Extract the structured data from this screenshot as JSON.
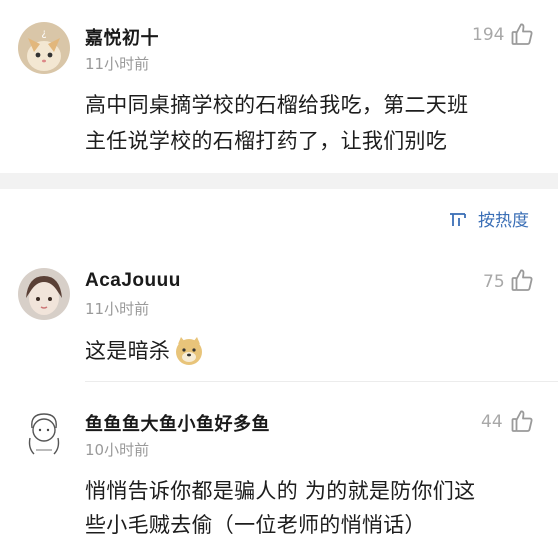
{
  "comments": [
    {
      "name": "嘉悦初十",
      "time": "11小时前",
      "likes": "194",
      "text_lines": [
        "高中同桌摘学校的石榴给我吃，第二天班",
        "主任说学校的石榴打药了，让我们别吃"
      ]
    },
    {
      "name": "AcaJouuu",
      "time": "11小时前",
      "likes": "75",
      "text_lines": [
        "这是暗杀"
      ],
      "emoji": "doge-emoji"
    },
    {
      "name": "鱼鱼鱼大鱼小鱼好多鱼",
      "time": "10小时前",
      "likes": "44",
      "text_lines": [
        "悄悄告诉你都是骗人的 为的就是防你们这",
        "些小毛贼去偷（一位老师的悄悄话）"
      ]
    }
  ],
  "sort": {
    "label": "按热度",
    "icon": "sort-icon"
  },
  "colors": {
    "accent": "#3b6fb6",
    "muted": "#9a9a9a",
    "separator": "#f2f2f2"
  }
}
